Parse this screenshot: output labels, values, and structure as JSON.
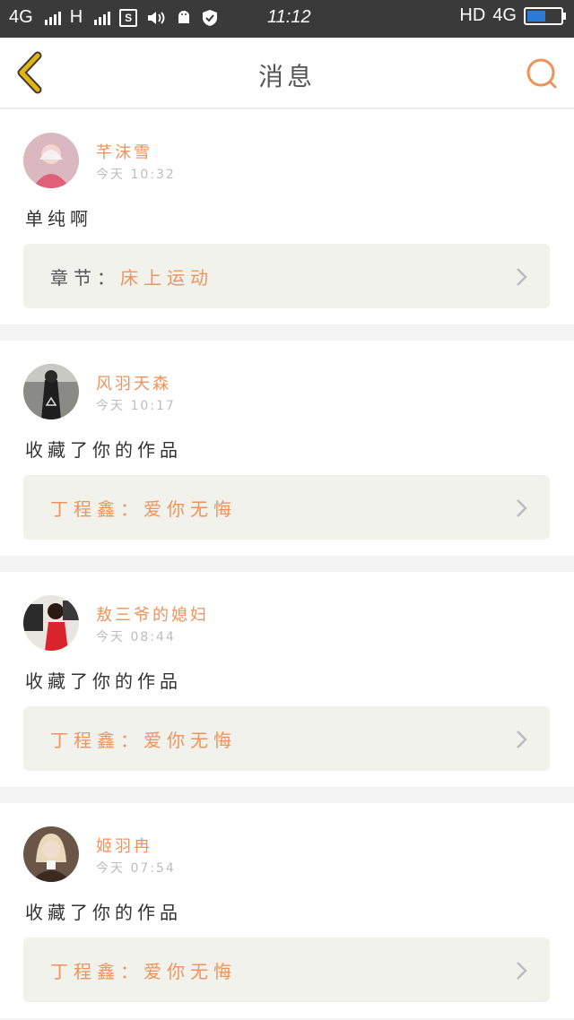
{
  "status_bar": {
    "network1": "4G",
    "network2": "H",
    "time": "11:12",
    "hd": "HD",
    "network3": "4G"
  },
  "header": {
    "title": "消息"
  },
  "messages": [
    {
      "username": "芊沫雪",
      "time": "今天 10:32",
      "text": "单纯啊",
      "ref_prefix": "章节：",
      "ref_name": "床上运动"
    },
    {
      "username": "风羽天森",
      "time": "今天 10:17",
      "text": "收藏了你的作品",
      "ref_prefix": "",
      "ref_name": "丁程鑫：爱你无悔"
    },
    {
      "username": "敖三爷的媳妇",
      "time": "今天 08:44",
      "text": "收藏了你的作品",
      "ref_prefix": "",
      "ref_name": "丁程鑫：爱你无悔"
    },
    {
      "username": "姬羽冉",
      "time": "今天 07:54",
      "text": "收藏了你的作品",
      "ref_prefix": "",
      "ref_name": "丁程鑫：爱你无悔"
    }
  ],
  "colors": {
    "accent": "#f0935a",
    "back_arrow": "#e6b40f",
    "status_bar": "#3a3a3a"
  }
}
